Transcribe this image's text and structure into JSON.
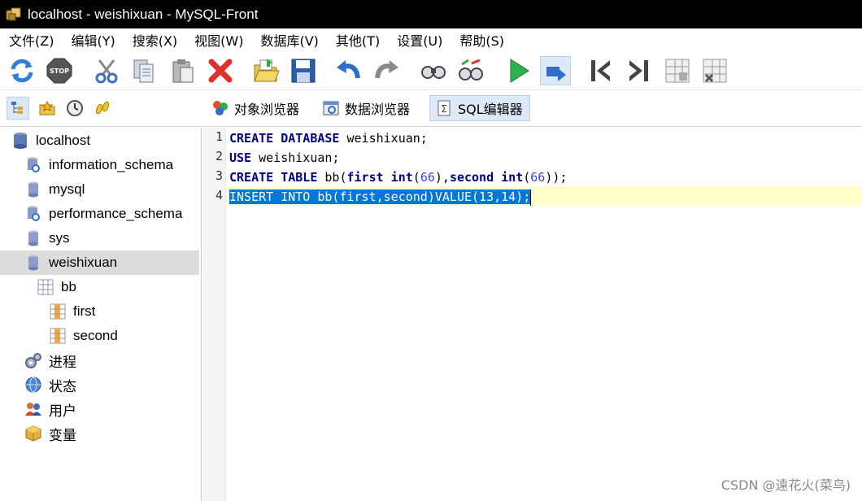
{
  "window": {
    "title": "localhost - weishixuan - MySQL-Front"
  },
  "menu": [
    "文件(Z)",
    "编辑(Y)",
    "搜索(X)",
    "视图(W)",
    "数据库(V)",
    "其他(T)",
    "设置(U)",
    "帮助(S)"
  ],
  "toolbar": {
    "icons": [
      "refresh-icon",
      "stop-icon",
      "cut-icon",
      "copy-icon",
      "paste-icon",
      "delete-icon",
      "open-icon",
      "save-icon",
      "undo-icon",
      "redo-icon",
      "find-icon",
      "replace-icon",
      "run-icon",
      "run-selection-icon",
      "first-icon",
      "last-icon",
      "insert-record-icon",
      "delete-record-icon"
    ],
    "stop_label": "STOP"
  },
  "viewbar": {
    "tabs": [
      {
        "label": "对象浏览器",
        "icon": "object-browser-icon"
      },
      {
        "label": "数据浏览器",
        "icon": "data-browser-icon"
      },
      {
        "label": "SQL编辑器",
        "icon": "sql-editor-icon",
        "active": true
      }
    ]
  },
  "tree": {
    "items": [
      {
        "label": "localhost",
        "icon": "server-icon",
        "level": 0
      },
      {
        "label": "information_schema",
        "icon": "system-database-icon",
        "level": 1
      },
      {
        "label": "mysql",
        "icon": "database-icon",
        "level": 1
      },
      {
        "label": "performance_schema",
        "icon": "system-database-icon",
        "level": 1
      },
      {
        "label": "sys",
        "icon": "database-icon",
        "level": 1
      },
      {
        "label": "weishixuan",
        "icon": "database-icon",
        "level": 1,
        "selected": true
      },
      {
        "label": "bb",
        "icon": "table-icon",
        "level": 2
      },
      {
        "label": "first",
        "icon": "field-icon",
        "level": 3
      },
      {
        "label": "second",
        "icon": "field-icon",
        "level": 3
      },
      {
        "label": "进程",
        "icon": "processes-icon",
        "level": 1
      },
      {
        "label": "状态",
        "icon": "status-icon",
        "level": 1
      },
      {
        "label": "用户",
        "icon": "users-icon",
        "level": 1
      },
      {
        "label": "变量",
        "icon": "variables-icon",
        "level": 1
      }
    ]
  },
  "editor": {
    "line_numbers": [
      "1",
      "2",
      "3",
      "4"
    ],
    "lines": [
      {
        "t1": "CREATE DATABASE",
        "t2": " weishixuan;"
      },
      {
        "t1": "USE",
        "t2": " weishixuan;"
      },
      {
        "t1": "CREATE TABLE",
        "t2": " bb(",
        "t3": "first int",
        "t4": "(",
        "t5": "66",
        "t6": "),",
        "t7": "second int",
        "t8": "(",
        "t9": "66",
        "t10": "));"
      },
      {
        "text": "INSERT INTO bb(first,second)VALUE(13,14);"
      }
    ]
  },
  "watermark": "CSDN @遠花火(菜鸟)"
}
